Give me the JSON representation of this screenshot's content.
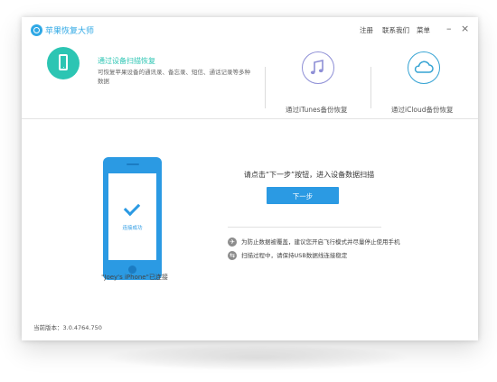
{
  "app": {
    "title": "苹果恢复大师",
    "menu": [
      "注册",
      "联系我们",
      "菜单"
    ],
    "window_controls": {
      "minimize": "–",
      "close": "×"
    }
  },
  "modes": {
    "active": {
      "title": "通过设备扫描恢复",
      "description": "可恢复苹果设备的通讯录、备忘录、短信、通话记录等多种数据",
      "icon": "phone-icon",
      "color": "#2cc5b3"
    },
    "itunes": {
      "label": "通过iTunes备份恢复",
      "icon": "music-note-icon",
      "color": "#8e8fd6"
    },
    "icloud": {
      "label": "通过iCloud备份恢复",
      "icon": "cloud-icon",
      "color": "#35a3d3"
    }
  },
  "device": {
    "status": "连接成功",
    "caption": "\"Joey's iPhone\"已连接",
    "color": "#2b9ae3"
  },
  "main": {
    "instruction": "请点击“下一步”按钮，进入设备数据扫描",
    "next_button": "下一步",
    "tips": [
      {
        "icon": "plane-icon",
        "text": "为防止数据被覆盖，建议您开启飞行模式并尽量停止使用手机"
      },
      {
        "icon": "usb-icon",
        "text": "扫描过程中，请保持USB数据线连接稳定"
      }
    ]
  },
  "footer": {
    "version": "当前版本：3.0.4764.750"
  }
}
